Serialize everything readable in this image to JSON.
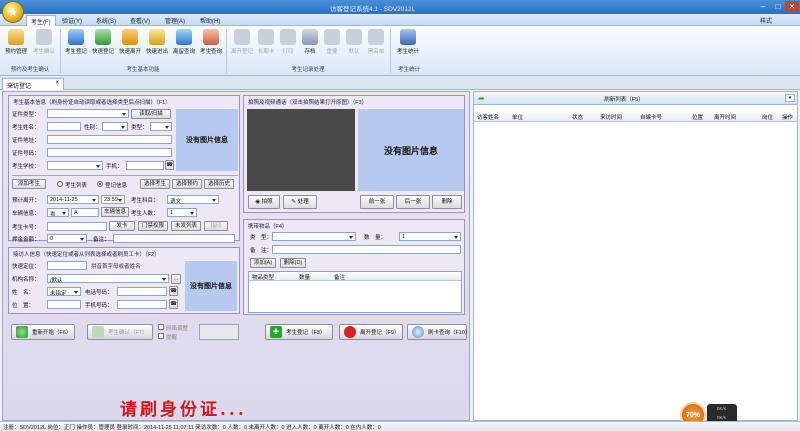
{
  "window": {
    "title": "访客登记系统4.1 - SDV2012L",
    "min": "–",
    "max": "□",
    "close": "✕"
  },
  "menu": {
    "items": [
      "考生(F)",
      "验证(Y)",
      "系统(S)",
      "查看(V)",
      "管理(A)",
      "帮助(H)"
    ],
    "style": "样式"
  },
  "ribbon": {
    "buttons": [
      "预约管理",
      "考生确认",
      "考生登记",
      "快速登记",
      "快速离开",
      "快速进出",
      "离留查询",
      "考生查询",
      "离开登记",
      "长期卡",
      "打印",
      "存档",
      "重要",
      "默认",
      "黑名单",
      "考生统计"
    ],
    "groups": [
      "预约及考生确认",
      "考生基本功能",
      "考生记录处理",
      "考生统计"
    ]
  },
  "doc_tab": {
    "label": "来访登记",
    "close": "×"
  },
  "basic": {
    "title": "考生基本信息（刷身份证自动读取或者选择类型后点扫描）（F1）",
    "id_type_label": "证件类型：",
    "read_scan": "读取/扫描",
    "name_label": "考生姓名：",
    "gender_label": "性别：",
    "type_label": "类型：",
    "address_label": "证件地址：",
    "id_no_label": "证件号码：",
    "school_label": "考生学校：",
    "phone_label": "手机：",
    "no_photo": "没有图片信息",
    "add_student": "添加考生",
    "radio_list": "考生列表",
    "radio_login": "登记信息",
    "choose_student": "选择考生",
    "choose_booking": "选择预约",
    "choose_history": "选择历史",
    "date_label": "预计离开：",
    "date": "2014-11-25",
    "time": "23:59",
    "subject_label": "考生科目：",
    "subject": "语文",
    "plate_label": "车辆信息：",
    "plate_prov": "粤",
    "plate_letter": "A",
    "vehicle_btn": "车辆信息",
    "count_label": "考生人数：",
    "count": "1",
    "card_label": "考生卡号：",
    "issue_card": "发卡",
    "gate_perm": "门禁权限",
    "unissued": "未发列表",
    "print": "指印",
    "deposit_label": "押金金额：",
    "deposit": "0",
    "remark_label": "备注："
  },
  "receiver": {
    "title": "接访人信息（快速定位或者从列表选择或者刷员工卡）（F2）",
    "quick_label": "快速定位：",
    "pinyin": "拼音首字母或者姓名",
    "org_label": "机构名称：",
    "org": "/默认",
    "name_label": "姓　名：",
    "name": "未指定",
    "tel_label": "电话号码：",
    "pos_label": "位　置：",
    "mobile_label": "手机号码：",
    "no_photo": "没有图片信息",
    "more": "..."
  },
  "photo": {
    "title": "拍照及视频通话（双击拍照结果打开原图）（F3）",
    "no_photo": "没有图片信息",
    "take": "拍照",
    "process": "处理",
    "prev": "前一张",
    "next": "后一张",
    "delete": "删除"
  },
  "items": {
    "title": "携带物品（F4）",
    "type_label": "类　型：",
    "qty_label": "数　量：",
    "qty": "1",
    "remark_label": "备　注：",
    "add": "添加(A)",
    "remove": "删除(D)",
    "cols": [
      "物品类型",
      "数量",
      "备注"
    ]
  },
  "actions": {
    "reset": "重新开始（F6）",
    "confirm": "考生确认（F7）",
    "chk1": "网络调整",
    "chk2": "提醒",
    "register": "考生登记（F8）",
    "leave": "离开登记（F9）",
    "card_query": "刷卡查询（F10）"
  },
  "prompt": "请刷身份证...",
  "right": {
    "title": "刷新列表（F5）",
    "cols": [
      "访客姓名",
      "单位",
      "状态",
      "来访时间",
      "自编卡号",
      "位置",
      "离开时间",
      "岗位",
      "操作"
    ]
  },
  "status": "注册：SDV2012L  岗位：正门  操作员：管理员  登录时间：2014-11-25 11:07:11  来访次数：0 人数：0  未离开人数：0  进入人数：0  离开人数：0  在内人数：0",
  "gauge": {
    "percent": "70%",
    "up": "0K/s",
    "down": "0K/s"
  },
  "colors": {
    "accent": "#2a70c0",
    "prompt": "#d01818",
    "panel": "#ece8f6",
    "no_photo_bg": "#b7c9ee"
  }
}
